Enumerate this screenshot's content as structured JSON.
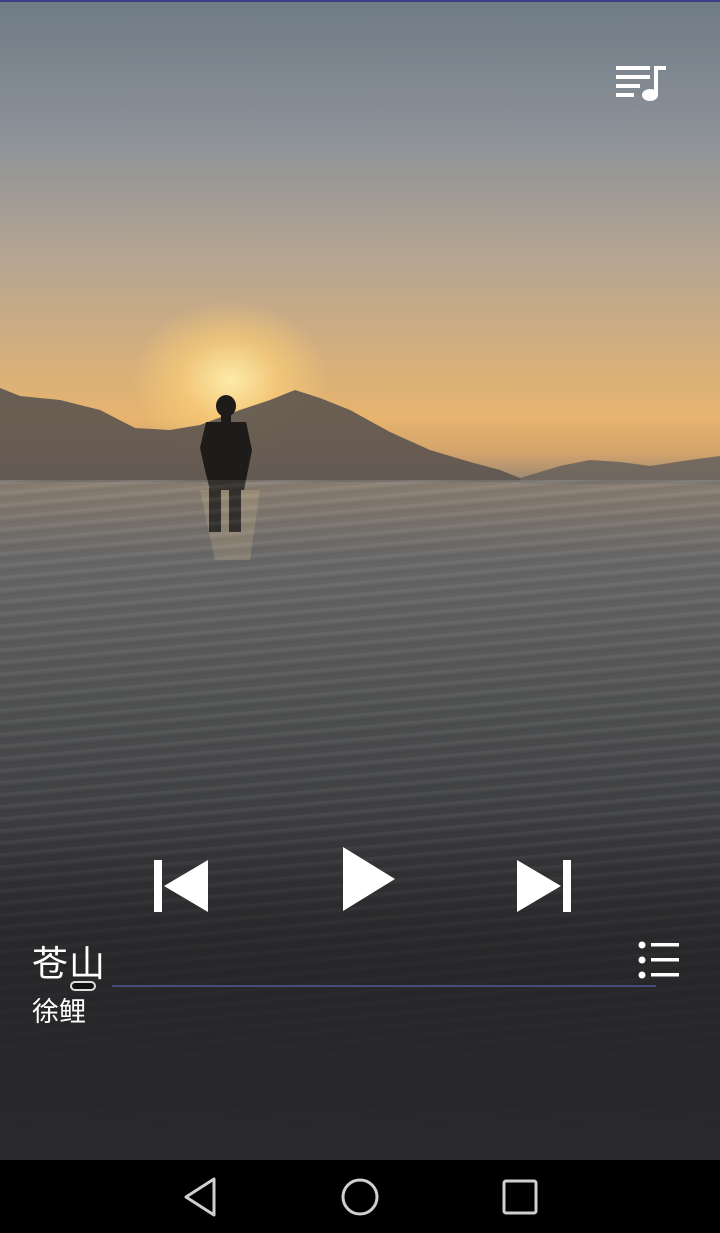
{
  "app": {
    "screen": "music-player"
  },
  "track": {
    "title": "苍山",
    "artist": "徐鲤",
    "progress": 0.0
  },
  "icons": {
    "top_right": "playlist-music-icon",
    "prev": "skip-previous-icon",
    "play": "play-icon",
    "next": "skip-next-icon",
    "list": "list-icon",
    "nav_back": "back-triangle-icon",
    "nav_home": "home-circle-icon",
    "nav_recent": "recent-apps-square-icon"
  },
  "colors": {
    "status_line": "#3b3f86",
    "progress_track": "#4a4b7a",
    "icon": "#ffffff",
    "nav_bar": "#000000"
  }
}
